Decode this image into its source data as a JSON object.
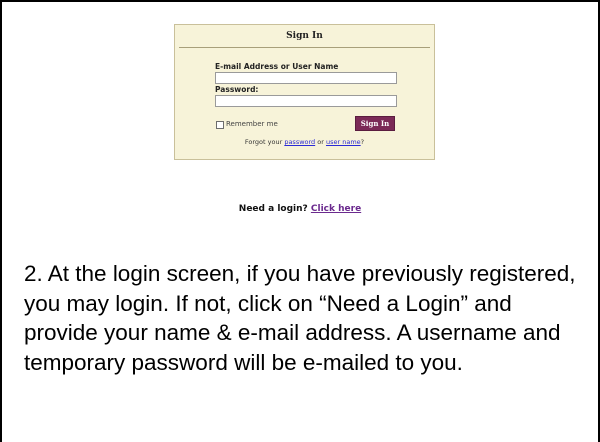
{
  "signin": {
    "title": "Sign In",
    "email_label": "E-mail Address or User Name",
    "email_value": "",
    "password_label": "Password:",
    "password_value": "",
    "remember_label": "Remember me",
    "remember_checked": false,
    "button_label": "Sign In",
    "forgot_prefix": "Forgot your ",
    "forgot_password_link": "password",
    "forgot_or": " or ",
    "forgot_username_link": "user name",
    "forgot_suffix": "?"
  },
  "need_login": {
    "text": "Need a login? ",
    "link": "Click here"
  },
  "instructions": "2. At the login screen, if you have previously registered, you may login. If not, click on “Need a Login” and provide your name & e-mail address. A username and temporary password will be e-mailed to you.",
  "colors": {
    "panel_bg": "#f7f3d9",
    "button_bg": "#7b2a57",
    "link": "#2a2ad6"
  }
}
